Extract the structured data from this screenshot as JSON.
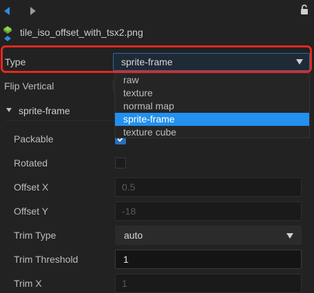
{
  "toolbar": {
    "back_icon": "back-arrow-icon",
    "forward_icon": "forward-arrow-icon",
    "lock_icon": "lock-icon"
  },
  "asset": {
    "filename": "tile_iso_offset_with_tsx2.png",
    "icon": "image-asset-icon"
  },
  "type_field": {
    "label": "Type",
    "value": "sprite-frame"
  },
  "dropdown": {
    "options": [
      "raw",
      "texture",
      "normal map",
      "sprite-frame",
      "texture cube"
    ],
    "selected": "sprite-frame"
  },
  "flip_vertical": {
    "label": "Flip Vertical"
  },
  "section": {
    "title": "sprite-frame"
  },
  "props": {
    "packable": {
      "label": "Packable",
      "checked": true
    },
    "rotated": {
      "label": "Rotated",
      "checked": false
    },
    "offset_x": {
      "label": "Offset X",
      "value": "0.5"
    },
    "offset_y": {
      "label": "Offset Y",
      "value": "-18"
    },
    "trim_type": {
      "label": "Trim Type",
      "value": "auto"
    },
    "trim_threshold": {
      "label": "Trim Threshold",
      "value": "1"
    },
    "trim_x": {
      "label": "Trim X",
      "value": "1"
    }
  },
  "colors": {
    "accent": "#2390ee",
    "highlight_border": "#e8281e",
    "background": "#222222"
  }
}
